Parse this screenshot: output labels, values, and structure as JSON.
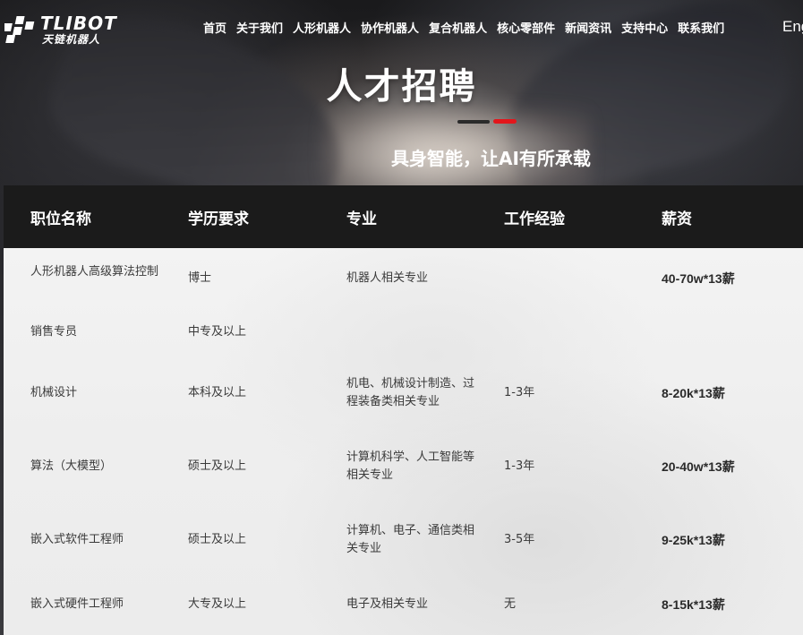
{
  "brand": {
    "logo_en": "TLIBOT",
    "logo_cn": "天链机器人"
  },
  "nav": {
    "items": [
      {
        "label": "首页"
      },
      {
        "label": "关于我们"
      },
      {
        "label": "人形机器人"
      },
      {
        "label": "协作机器人"
      },
      {
        "label": "复合机器人"
      },
      {
        "label": "核心零部件"
      },
      {
        "label": "新闻资讯"
      },
      {
        "label": "支持中心"
      },
      {
        "label": "联系我们"
      }
    ],
    "language": "Eng"
  },
  "hero": {
    "title": "人才招聘",
    "subtitle": "具身智能，让AI有所承载",
    "accent_color": "#e3161c"
  },
  "table": {
    "headers": [
      "职位名称",
      "学历要求",
      "专业",
      "工作经验",
      "薪资"
    ],
    "rows": [
      {
        "position": "人形机器人高级算法控制",
        "education": "博士",
        "major": "机器人相关专业",
        "experience": "",
        "salary": "40-70w*13薪"
      },
      {
        "position": "销售专员",
        "education": "中专及以上",
        "major": "",
        "experience": "",
        "salary": ""
      },
      {
        "position": "机械设计",
        "education": "本科及以上",
        "major": "机电、机械设计制造、过程装备类相关专业",
        "experience": "1-3年",
        "salary": "8-20k*13薪"
      },
      {
        "position": "算法（大模型）",
        "education": "硕士及以上",
        "major": "计算机科学、人工智能等相关专业",
        "experience": "1-3年",
        "salary": "20-40w*13薪"
      },
      {
        "position": "嵌入式软件工程师",
        "education": "硕士及以上",
        "major": "计算机、电子、通信类相关专业",
        "experience": "3-5年",
        "salary": "9-25k*13薪"
      },
      {
        "position": "嵌入式硬件工程师",
        "education": "大专及以上",
        "major": "电子及相关专业",
        "experience": "无",
        "salary": "8-15k*13薪"
      }
    ]
  }
}
